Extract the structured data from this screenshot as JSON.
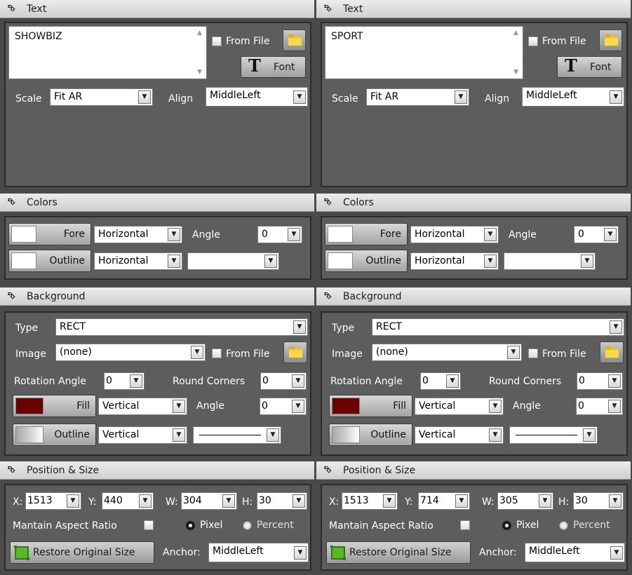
{
  "panels": [
    {
      "text_header": "Text",
      "text_value": "SHOWBIZ",
      "from_file_label": "From File",
      "font_label": "Font",
      "scale_label": "Scale",
      "scale_value": "Fit AR",
      "align_label": "Align",
      "align_value": "MiddleLeft",
      "colors_header": "Colors",
      "fore_label": "Fore",
      "fore_gradient": "Horizontal",
      "angle_label": "Angle",
      "fore_angle": "0",
      "outline_label": "Outline",
      "outline_gradient": "Horizontal",
      "outline_extra": "",
      "background_header": "Background",
      "type_label": "Type",
      "type_value": "RECT",
      "image_label": "Image",
      "image_value": "(none)",
      "bg_from_file_label": "From File",
      "rotation_label": "Rotation Angle",
      "rotation_value": "0",
      "round_label": "Round Corners",
      "round_value": "0",
      "fill_label": "Fill",
      "fill_gradient": "Vertical",
      "fill_angle_label": "Angle",
      "fill_angle": "0",
      "bg_outline_label": "Outline",
      "bg_outline_gradient": "Vertical",
      "position_header": "Position & Size",
      "x_label": "X:",
      "x_value": "1513",
      "y_label": "Y:",
      "y_value": "440",
      "w_label": "W:",
      "w_value": "304",
      "h_label": "H:",
      "h_value": "30",
      "aspect_label": "Mantain Aspect Ratio",
      "pixel_label": "Pixel",
      "percent_label": "Percent",
      "restore_label": "Restore Original Size",
      "anchor_label": "Anchor:",
      "anchor_value": "MiddleLeft"
    },
    {
      "text_header": "Text",
      "text_value": "SPORT",
      "from_file_label": "From File",
      "font_label": "Font",
      "scale_label": "Scale",
      "scale_value": "Fit AR",
      "align_label": "Align",
      "align_value": "MiddleLeft",
      "colors_header": "Colors",
      "fore_label": "Fore",
      "fore_gradient": "Horizontal",
      "angle_label": "Angle",
      "fore_angle": "0",
      "outline_label": "Outline",
      "outline_gradient": "Horizontal",
      "outline_extra": "",
      "background_header": "Background",
      "type_label": "Type",
      "type_value": "RECT",
      "image_label": "Image",
      "image_value": "(none)",
      "bg_from_file_label": "From File",
      "rotation_label": "Rotation Angle",
      "rotation_value": "0",
      "round_label": "Round Corners",
      "round_value": "0",
      "fill_label": "Fill",
      "fill_gradient": "Vertical",
      "fill_angle_label": "Angle",
      "fill_angle": "0",
      "bg_outline_label": "Outline",
      "bg_outline_gradient": "Vertical",
      "position_header": "Position & Size",
      "x_label": "X:",
      "x_value": "1513",
      "y_label": "Y:",
      "y_value": "714",
      "w_label": "W:",
      "w_value": "305",
      "h_label": "H:",
      "h_value": "30",
      "aspect_label": "Mantain Aspect Ratio",
      "pixel_label": "Pixel",
      "percent_label": "Percent",
      "restore_label": "Restore Original Size",
      "anchor_label": "Anchor:",
      "anchor_value": "MiddleLeft"
    }
  ],
  "colors": {
    "fore_swatch": "#ffffff",
    "outline_swatch": "#ffffff",
    "fill_swatch": "#6b0000",
    "bg_outline_swatch": "#d0d0d0"
  },
  "icons": {
    "collapse": "chevron-double-down-icon",
    "folder": "folder-icon",
    "font": "font-t-icon",
    "restore": "resize-icon",
    "dropdown": "chevron-down-icon"
  }
}
